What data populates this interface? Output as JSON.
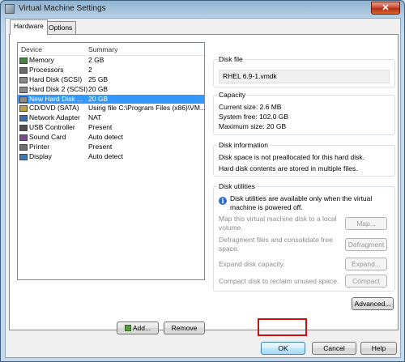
{
  "window": {
    "title": "Virtual Machine Settings",
    "close_glyph": "✕"
  },
  "tabs": [
    {
      "label": "Hardware",
      "active": true
    },
    {
      "label": "Options",
      "active": false
    }
  ],
  "device_list": {
    "columns": {
      "device": "Device",
      "summary": "Summary"
    },
    "rows": [
      {
        "device": "Memory",
        "summary": "2 GB",
        "icon": "memory-icon"
      },
      {
        "device": "Processors",
        "summary": "2",
        "icon": "processor-icon"
      },
      {
        "device": "Hard Disk (SCSI)",
        "summary": "25 GB",
        "icon": "hard-disk-icon"
      },
      {
        "device": "Hard Disk 2 (SCSI)",
        "summary": "20 GB",
        "icon": "hard-disk-icon"
      },
      {
        "device": "New Hard Disk ...",
        "summary": "20 GB",
        "icon": "hard-disk-icon",
        "selected": true
      },
      {
        "device": "CD/DVD (SATA)",
        "summary": "Using file C:\\Program Files (x86)\\VM...",
        "icon": "cd-dvd-icon"
      },
      {
        "device": "Network Adapter",
        "summary": "NAT",
        "icon": "network-adapter-icon"
      },
      {
        "device": "USB Controller",
        "summary": "Present",
        "icon": "usb-icon"
      },
      {
        "device": "Sound Card",
        "summary": "Auto detect",
        "icon": "sound-card-icon"
      },
      {
        "device": "Printer",
        "summary": "Present",
        "icon": "printer-icon"
      },
      {
        "device": "Display",
        "summary": "Auto detect",
        "icon": "display-icon"
      }
    ],
    "add_label": "Add...",
    "remove_label": "Remove"
  },
  "disk_file": {
    "title": "Disk file",
    "value": "RHEL 6.9-1.vmdk"
  },
  "capacity": {
    "title": "Capacity",
    "current_size": "Current size: 2.6 MB",
    "system_free": "System free: 102.0 GB",
    "maximum_size": "Maximum size: 20 GB"
  },
  "disk_information": {
    "title": "Disk information",
    "line1": "Disk space is not preallocated for this hard disk.",
    "line2": "Hard disk contents are stored in multiple files."
  },
  "disk_utilities": {
    "title": "Disk utilities",
    "notice": "Disk utilities are available only when the virtual machine is powered off.",
    "map_desc": "Map this virtual machine disk to a local volume.",
    "map_label": "Map...",
    "defrag_desc": "Defragment files and consolidate free space.",
    "defrag_label": "Defragment",
    "expand_desc": "Expand disk capacity.",
    "expand_label": "Expand...",
    "compact_desc": "Compact disk to reclaim unused space.",
    "compact_label": "Compact"
  },
  "advanced_label": "Advanced...",
  "footer": {
    "ok_label": "OK",
    "cancel_label": "Cancel",
    "help_label": "Help"
  },
  "colors": {
    "selection": "#3399ff",
    "highlight_box": "#d01010"
  }
}
